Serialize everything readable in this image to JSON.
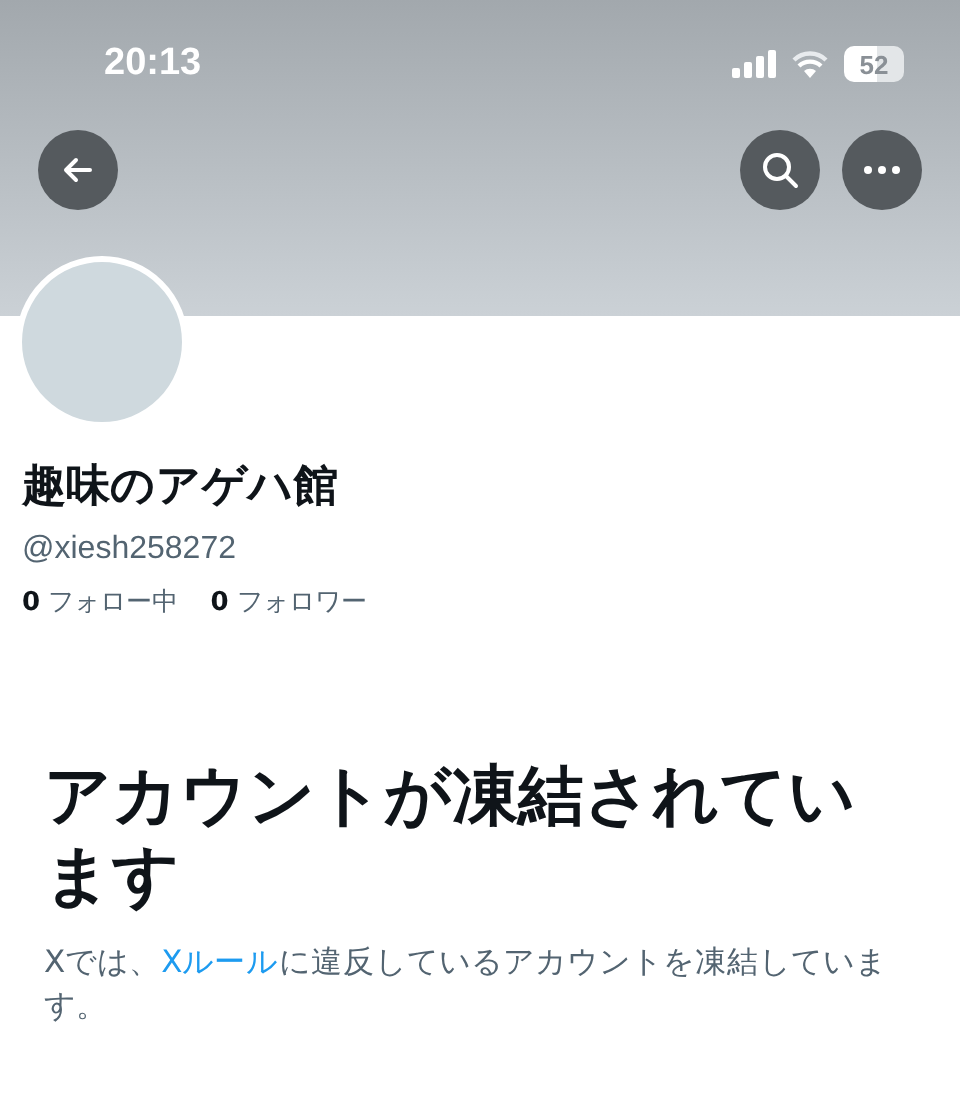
{
  "status_bar": {
    "time": "20:13",
    "battery": "52"
  },
  "profile": {
    "name": "趣味のアゲハ館",
    "handle": "@xiesh258272",
    "stats": [
      {
        "count": "0",
        "label": "フォロー中"
      },
      {
        "count": "0",
        "label": "フォロワー"
      }
    ]
  },
  "notice": {
    "title": "アカウントが凍結されています",
    "text_before": "Xでは、",
    "link": "Xルール",
    "text_after": "に違反しているアカウントを凍結しています。"
  }
}
